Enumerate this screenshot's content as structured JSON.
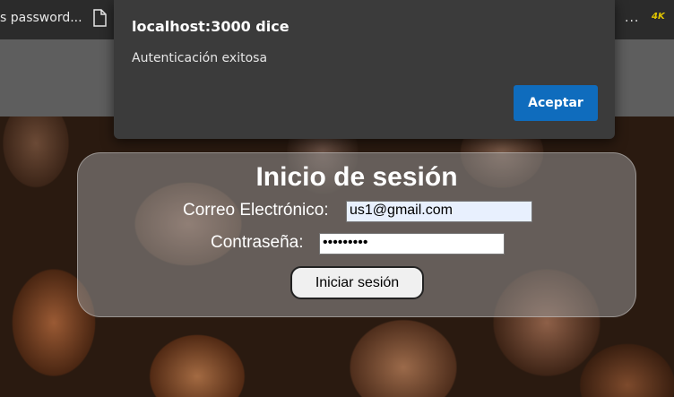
{
  "bookmarks": {
    "item_text": "s password...",
    "more_label": "...",
    "extension_label": "4K"
  },
  "login": {
    "title": "Inicio de sesión",
    "email_label": "Correo Electrónico:",
    "email_value": "us1@gmail.com",
    "password_label": "Contraseña:",
    "password_value": "•••••••••",
    "submit_label": "Iniciar sesión"
  },
  "dialog": {
    "title": "localhost:3000 dice",
    "message": "Autenticación exitosa",
    "accept_label": "Aceptar",
    "accept_color": "#0f6cbd"
  }
}
